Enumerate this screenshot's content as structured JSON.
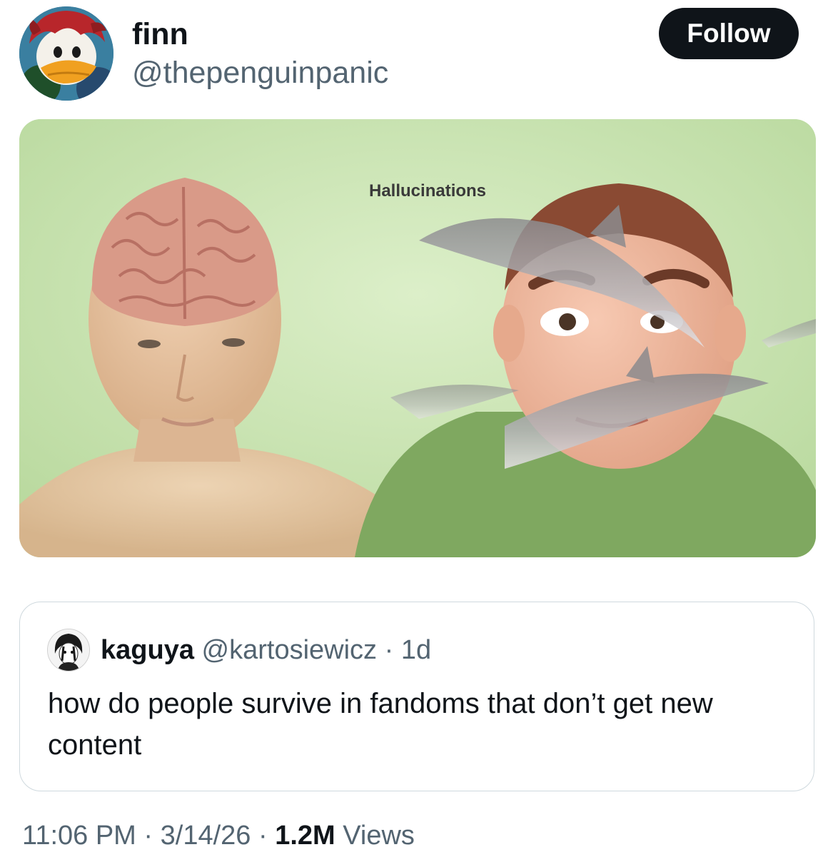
{
  "author": {
    "display_name": "finn",
    "handle": "@thepenguinpanic",
    "avatar_icon": "penguin-avatar"
  },
  "follow_button": {
    "label": "Follow"
  },
  "media": {
    "label_text": "Hallucinations"
  },
  "quoted_post": {
    "display_name": "kaguya",
    "handle": "@kartosiewicz",
    "separator": "·",
    "age": "1d",
    "text": "how do people survive in fandoms that don’t get new content"
  },
  "meta": {
    "time": "11:06 PM",
    "sep1": " · ",
    "date": "3/14/26",
    "sep2": " · ",
    "views_count": "1.2M",
    "views_label": " Views"
  },
  "colors": {
    "primary_text": "#0f1419",
    "secondary_text": "#536471",
    "follow_bg": "#0f1419",
    "border": "#cfd9de",
    "media_bg": "#c9e3b6"
  }
}
